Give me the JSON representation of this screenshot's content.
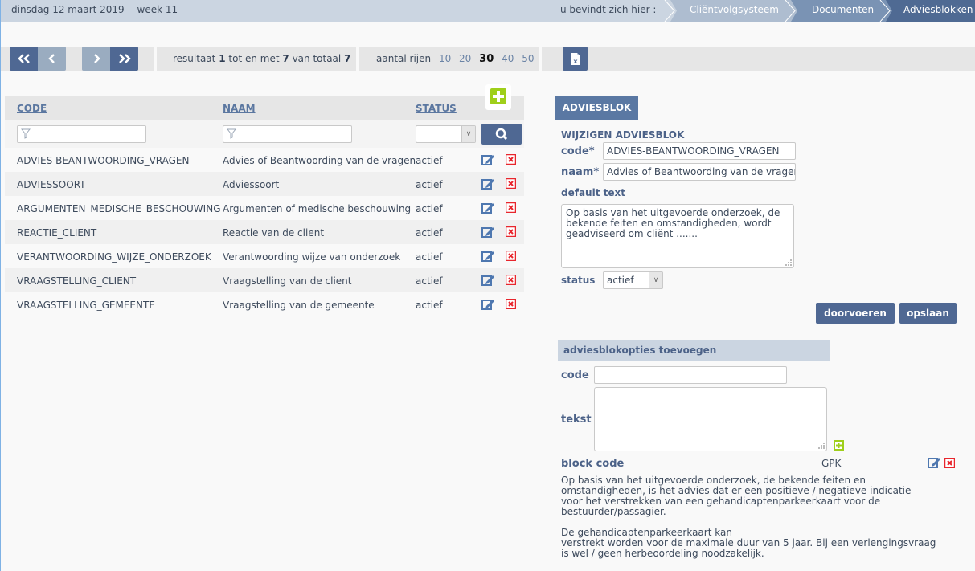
{
  "topbar": {
    "date": "dinsdag 12 maart 2019",
    "week": "week 11",
    "breadcrumb_label": "u bevindt zich hier :",
    "breadcrumb": [
      "Cliëntvolgsysteem",
      "Documenten",
      "Adviesblokken"
    ]
  },
  "pagination": {
    "first_icon": "double-chevron-left-icon",
    "prev_icon": "chevron-left-icon",
    "next_icon": "chevron-right-icon",
    "last_icon": "double-chevron-right-icon",
    "result_prefix": "resultaat",
    "result_from": "1",
    "result_mid": "tot en met",
    "result_to": "7",
    "result_total_label": "van totaal",
    "result_total": "7",
    "rows_label": "aantal rijen",
    "rows_options": [
      "10",
      "20",
      "30",
      "40",
      "50"
    ],
    "rows_selected": "30",
    "export_icon": "excel-export-icon"
  },
  "table": {
    "columns": [
      "CODE",
      "NAAM",
      "STATUS"
    ],
    "filters": {
      "code": "",
      "naam": "",
      "status": ""
    },
    "rows": [
      {
        "code": "ADVIES-BEANTWOORDING_VRAGEN",
        "naam": "Advies of Beantwoording van de vragen",
        "status": "actief"
      },
      {
        "code": "ADVIESSOORT",
        "naam": "Adviessoort",
        "status": "actief"
      },
      {
        "code": "ARGUMENTEN_MEDISCHE_BESCHOUWING",
        "naam": "Argumenten of medische beschouwing",
        "status": "actief"
      },
      {
        "code": "REACTIE_CLIENT",
        "naam": "Reactie van de client",
        "status": "actief"
      },
      {
        "code": "VERANTWOORDING_WIJZE_ONDERZOEK",
        "naam": "Verantwoording wijze van onderzoek",
        "status": "actief"
      },
      {
        "code": "VRAAGSTELLING_CLIENT",
        "naam": "Vraagstelling van de client",
        "status": "actief"
      },
      {
        "code": "VRAAGSTELLING_GEMEENTE",
        "naam": "Vraagstelling van de gemeente",
        "status": "actief"
      }
    ]
  },
  "form": {
    "tab": "ADVIESBLOK",
    "title": "WIJZIGEN ADVIESBLOK",
    "code_label": "code*",
    "code_value": "ADVIES-BEANTWOORDING_VRAGEN",
    "naam_label": "naam*",
    "naam_value": "Advies of Beantwoording van de vragen",
    "default_text_label": "default text",
    "default_text_value": "Op basis van het uitgevoerde onderzoek, de bekende feiten en omstandigheden, wordt geadviseerd om cliënt .......",
    "status_label": "status",
    "status_value": "actief",
    "doorvoeren_label": "doorvoeren",
    "opslaan_label": "opslaan"
  },
  "options": {
    "heading": "adviesblokopties toevoegen",
    "code_label": "code",
    "code_value": "",
    "tekst_label": "tekst",
    "tekst_value": "",
    "block_code_label": "block code",
    "block_code_value": "GPK",
    "block_text": "Op basis van het uitgevoerde onderzoek, de bekende feiten en\nomstandigheden, is het advies dat er een positieve / negatieve indicatie\nvoor het verstrekken van een gehandicaptenparkeerkaart voor de\nbestuurder/passagier.\n\nDe gehandicaptenparkeerkaart kan\nverstrekt worden voor de maximale duur van 5 jaar. Bij een verlengingsvraag\nis wel / geen herbeoordeling noodzakelijk."
  },
  "colors": {
    "primary": "#4f6893",
    "accent_green": "#9fcf1a",
    "delete_red": "#e8262d",
    "header_bg": "#cbd5e1"
  }
}
